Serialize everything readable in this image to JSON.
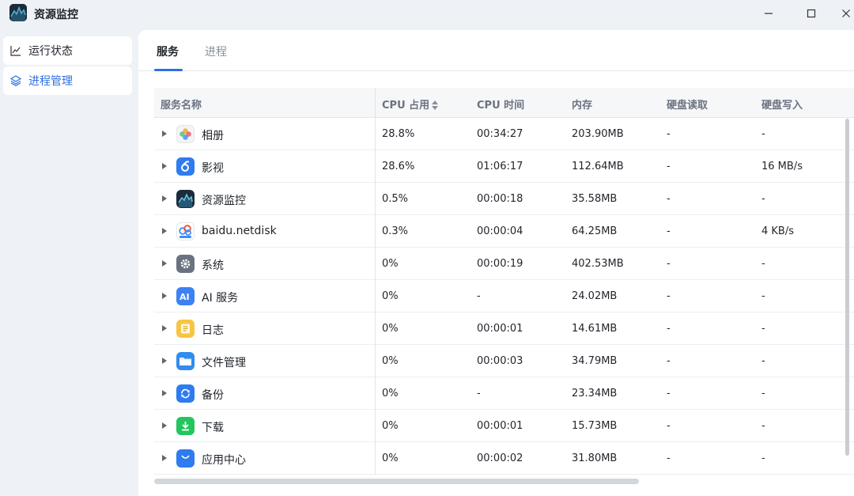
{
  "window": {
    "title": "资源监控"
  },
  "sidebar": {
    "items": [
      {
        "label": "运行状态",
        "icon": "line-chart-icon"
      },
      {
        "label": "进程管理",
        "icon": "layers-icon"
      }
    ]
  },
  "tabs": [
    {
      "label": "服务"
    },
    {
      "label": "进程"
    }
  ],
  "table": {
    "columns": [
      "服务名称",
      "CPU 占用",
      "CPU 时间",
      "内存",
      "硬盘读取",
      "硬盘写入"
    ],
    "rows": [
      {
        "name": "相册",
        "icon": "photos-icon",
        "cpu": "28.8%",
        "cpu_time": "00:34:27",
        "memory": "203.90MB",
        "disk_read": "-",
        "disk_write": "-"
      },
      {
        "name": "影视",
        "icon": "video-icon",
        "cpu": "28.6%",
        "cpu_time": "01:06:17",
        "memory": "112.64MB",
        "disk_read": "-",
        "disk_write": "16 MB/s"
      },
      {
        "name": "资源监控",
        "icon": "resource-monitor-icon",
        "cpu": "0.5%",
        "cpu_time": "00:00:18",
        "memory": "35.58MB",
        "disk_read": "-",
        "disk_write": "-"
      },
      {
        "name": "baidu.netdisk",
        "icon": "netdisk-icon",
        "cpu": "0.3%",
        "cpu_time": "00:00:04",
        "memory": "64.25MB",
        "disk_read": "-",
        "disk_write": "4 KB/s"
      },
      {
        "name": "系统",
        "icon": "gear-icon",
        "cpu": "0%",
        "cpu_time": "00:00:19",
        "memory": "402.53MB",
        "disk_read": "-",
        "disk_write": "-"
      },
      {
        "name": "AI 服务",
        "icon": "ai-icon",
        "cpu": "0%",
        "cpu_time": "-",
        "memory": "24.02MB",
        "disk_read": "-",
        "disk_write": "-"
      },
      {
        "name": "日志",
        "icon": "log-icon",
        "cpu": "0%",
        "cpu_time": "00:00:01",
        "memory": "14.61MB",
        "disk_read": "-",
        "disk_write": "-"
      },
      {
        "name": "文件管理",
        "icon": "folder-icon",
        "cpu": "0%",
        "cpu_time": "00:00:03",
        "memory": "34.79MB",
        "disk_read": "-",
        "disk_write": "-"
      },
      {
        "name": "备份",
        "icon": "backup-icon",
        "cpu": "0%",
        "cpu_time": "-",
        "memory": "23.34MB",
        "disk_read": "-",
        "disk_write": "-"
      },
      {
        "name": "下载",
        "icon": "download-icon",
        "cpu": "0%",
        "cpu_time": "00:00:01",
        "memory": "15.73MB",
        "disk_read": "-",
        "disk_write": "-"
      },
      {
        "name": "应用中心",
        "icon": "app-store-icon",
        "cpu": "0%",
        "cpu_time": "00:00:02",
        "memory": "31.80MB",
        "disk_read": "-",
        "disk_write": "-"
      }
    ]
  },
  "colors": {
    "accent": "#2f6fe4",
    "background": "#eef1f6",
    "panel": "#ffffff"
  }
}
